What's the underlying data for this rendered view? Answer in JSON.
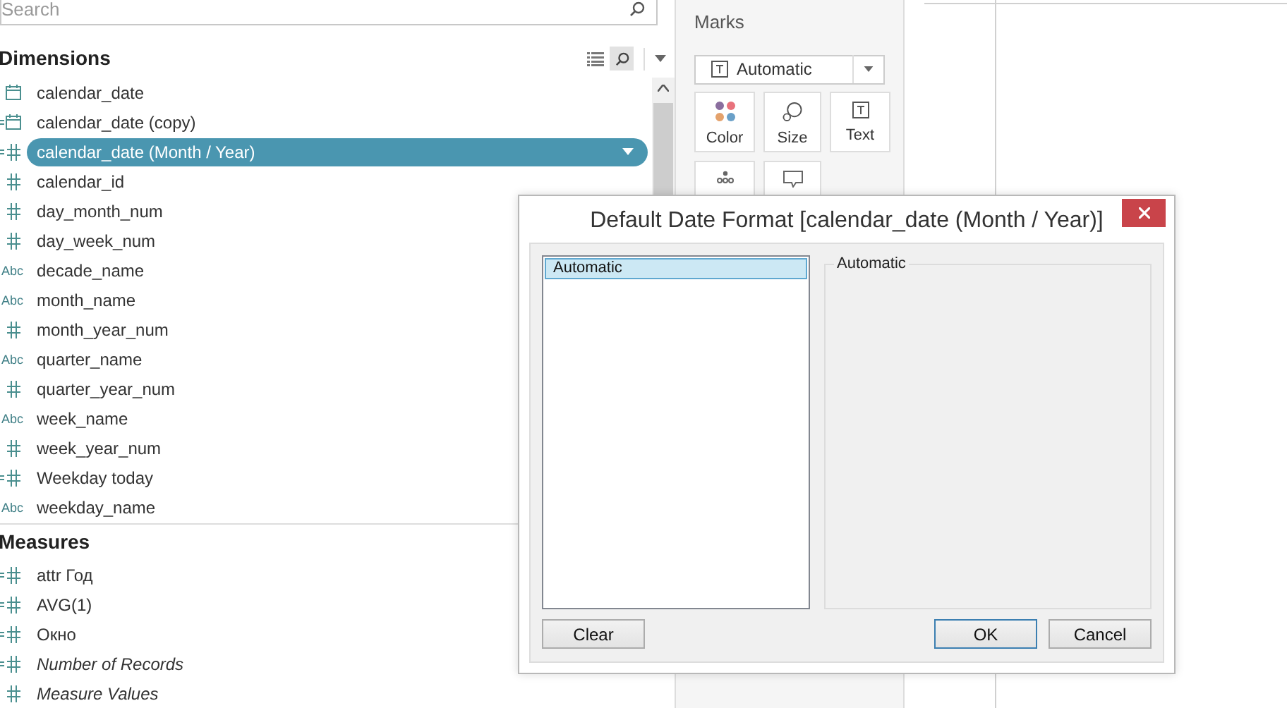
{
  "search": {
    "placeholder": "Search"
  },
  "dimensions": {
    "title": "Dimensions",
    "fields": [
      {
        "label": "calendar_date",
        "kind": "date",
        "calculated": false,
        "selected": false,
        "italic": false
      },
      {
        "label": "calendar_date (copy)",
        "kind": "date",
        "calculated": true,
        "selected": false,
        "italic": false
      },
      {
        "label": "calendar_date (Month / Year)",
        "kind": "number",
        "calculated": true,
        "selected": true,
        "italic": false
      },
      {
        "label": "calendar_id",
        "kind": "number",
        "calculated": false,
        "selected": false,
        "italic": false
      },
      {
        "label": "day_month_num",
        "kind": "number",
        "calculated": false,
        "selected": false,
        "italic": false
      },
      {
        "label": "day_week_num",
        "kind": "number",
        "calculated": false,
        "selected": false,
        "italic": false
      },
      {
        "label": "decade_name",
        "kind": "string",
        "type_label": "Abc",
        "calculated": false,
        "selected": false,
        "italic": false
      },
      {
        "label": "month_name",
        "kind": "string",
        "type_label": "Abc",
        "calculated": false,
        "selected": false,
        "italic": false
      },
      {
        "label": "month_year_num",
        "kind": "number",
        "calculated": false,
        "selected": false,
        "italic": false
      },
      {
        "label": "quarter_name",
        "kind": "string",
        "type_label": "Abc",
        "calculated": false,
        "selected": false,
        "italic": false
      },
      {
        "label": "quarter_year_num",
        "kind": "number",
        "calculated": false,
        "selected": false,
        "italic": false
      },
      {
        "label": "week_name",
        "kind": "string",
        "type_label": "Abc",
        "calculated": false,
        "selected": false,
        "italic": false
      },
      {
        "label": "week_year_num",
        "kind": "number",
        "calculated": false,
        "selected": false,
        "italic": false
      },
      {
        "label": "Weekday today",
        "kind": "number",
        "calculated": true,
        "selected": false,
        "italic": false
      },
      {
        "label": "weekday_name",
        "kind": "string",
        "type_label": "Abc",
        "calculated": false,
        "selected": false,
        "italic": false
      }
    ]
  },
  "measures": {
    "title": "Measures",
    "fields": [
      {
        "label": "attr Год",
        "kind": "number",
        "calculated": true,
        "selected": false,
        "italic": false
      },
      {
        "label": "AVG(1)",
        "kind": "number",
        "calculated": true,
        "selected": false,
        "italic": false
      },
      {
        "label": "Окно",
        "kind": "number",
        "calculated": true,
        "selected": false,
        "italic": false
      },
      {
        "label": "Number of Records",
        "kind": "number",
        "calculated": true,
        "selected": false,
        "italic": true
      },
      {
        "label": "Measure Values",
        "kind": "number",
        "calculated": false,
        "selected": false,
        "italic": true
      }
    ]
  },
  "marks": {
    "title": "Marks",
    "mark_type": "Automatic",
    "cards": [
      {
        "kind": "color",
        "label": "Color"
      },
      {
        "kind": "size",
        "label": "Size"
      },
      {
        "kind": "text",
        "label": "Text"
      },
      {
        "kind": "detail"
      },
      {
        "kind": "tooltip"
      }
    ]
  },
  "dialog": {
    "title": "Default Date Format [calendar_date (Month / Year)]",
    "formats": [
      {
        "label": "Automatic",
        "selected": true
      }
    ],
    "group_title": "Automatic",
    "buttons": [
      {
        "label": "Clear",
        "kind": "left",
        "default": false
      },
      {
        "label": "OK",
        "kind": "right",
        "default": true
      },
      {
        "label": "Cancel",
        "kind": "right",
        "default": false
      }
    ]
  }
}
